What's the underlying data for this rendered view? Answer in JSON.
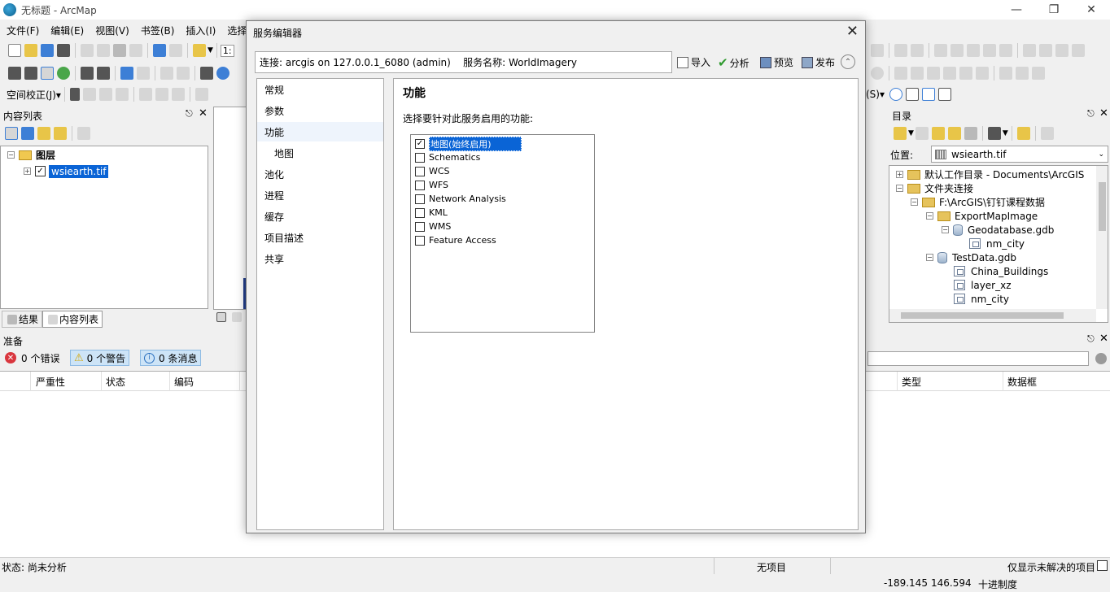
{
  "window": {
    "title": "无标题 - ArcMap"
  },
  "menu": [
    "文件(F)",
    "编辑(E)",
    "视图(V)",
    "书签(B)",
    "插入(I)",
    "选择"
  ],
  "toolbar": {
    "scale_prefix": "1:",
    "georef_label": "空间校正(J)▾",
    "s_label": "(S)▾"
  },
  "toc": {
    "title": "内容列表",
    "root": "图层",
    "layer": "wsiearth.tif",
    "tabs": [
      "结果",
      "内容列表"
    ]
  },
  "catalog": {
    "title": "目录",
    "location_label": "位置:",
    "location_value": "wsiearth.tif",
    "tree": [
      "默认工作目录 - Documents\\ArcGIS",
      "文件夹连接",
      "F:\\ArcGIS\\钉钉课程数据",
      "ExportMapImage",
      "Geodatabase.gdb",
      "nm_city",
      "TestData.gdb",
      "China_Buildings",
      "layer_xz",
      "nm_city"
    ]
  },
  "prepare": {
    "title": "准备",
    "errors": "0 个错误",
    "warnings": "0 个警告",
    "messages": "0 条消息",
    "columns": [
      "严重性",
      "状态",
      "编码",
      "类型",
      "数据框"
    ]
  },
  "dialog": {
    "title": "服务编辑器",
    "connection": "连接: arcgis on 127.0.0.1_6080 (admin)    服务名称: WorldImagery",
    "actions": {
      "import": "导入",
      "analyze": "分析",
      "preview": "预览",
      "publish": "发布"
    },
    "nav": [
      "常规",
      "参数",
      "功能",
      "地图",
      "池化",
      "进程",
      "缓存",
      "项目描述",
      "共享"
    ],
    "section_title": "功能",
    "instruction": "选择要针对此服务启用的功能:",
    "capabilities": [
      {
        "label": "地图(始终启用)",
        "checked": true
      },
      {
        "label": "Schematics",
        "checked": false
      },
      {
        "label": "WCS",
        "checked": false
      },
      {
        "label": "WFS",
        "checked": false
      },
      {
        "label": "Network Analysis",
        "checked": false
      },
      {
        "label": "KML",
        "checked": false
      },
      {
        "label": "WMS",
        "checked": false
      },
      {
        "label": "Feature Access",
        "checked": false
      }
    ]
  },
  "status": {
    "left": "状态: 尚未分析",
    "center": "无项目",
    "right": "仅显示未解决的项目",
    "x": "-189.145",
    "y": "146.594",
    "units": "十进制度"
  }
}
